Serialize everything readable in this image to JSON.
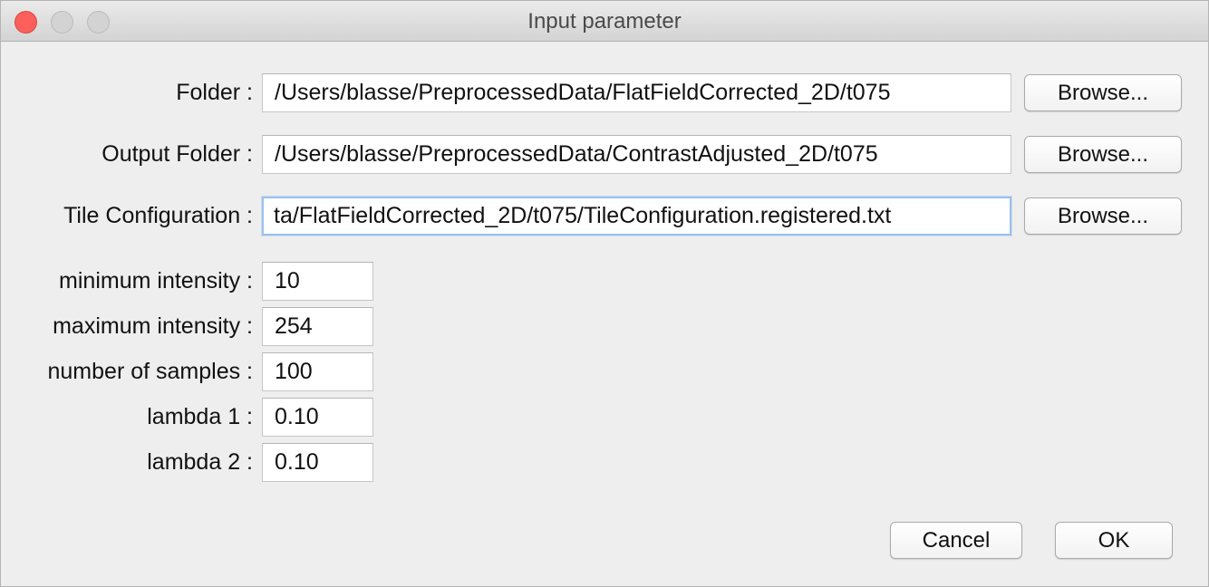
{
  "window": {
    "title": "Input parameter"
  },
  "paths": [
    {
      "label": "Folder :",
      "value": "/Users/blasse/PreprocessedData/FlatFieldCorrected_2D/t075",
      "button": "Browse..."
    },
    {
      "label": "Output Folder :",
      "value": "/Users/blasse/PreprocessedData/ContrastAdjusted_2D/t075",
      "button": "Browse..."
    },
    {
      "label": "Tile Configuration :",
      "value": "ta/FlatFieldCorrected_2D/t075/TileConfiguration.registered.txt",
      "button": "Browse..."
    }
  ],
  "params": [
    {
      "label": "minimum intensity :",
      "value": "10"
    },
    {
      "label": "maximum intensity :",
      "value": "254"
    },
    {
      "label": "number of samples :",
      "value": "100"
    },
    {
      "label": "lambda 1 :",
      "value": "0.10"
    },
    {
      "label": "lambda 2 :",
      "value": "0.10"
    }
  ],
  "actions": {
    "cancel": "Cancel",
    "ok": "OK"
  },
  "colors": {
    "close": "#fc605c",
    "focus_ring": "#9cc0ea"
  }
}
